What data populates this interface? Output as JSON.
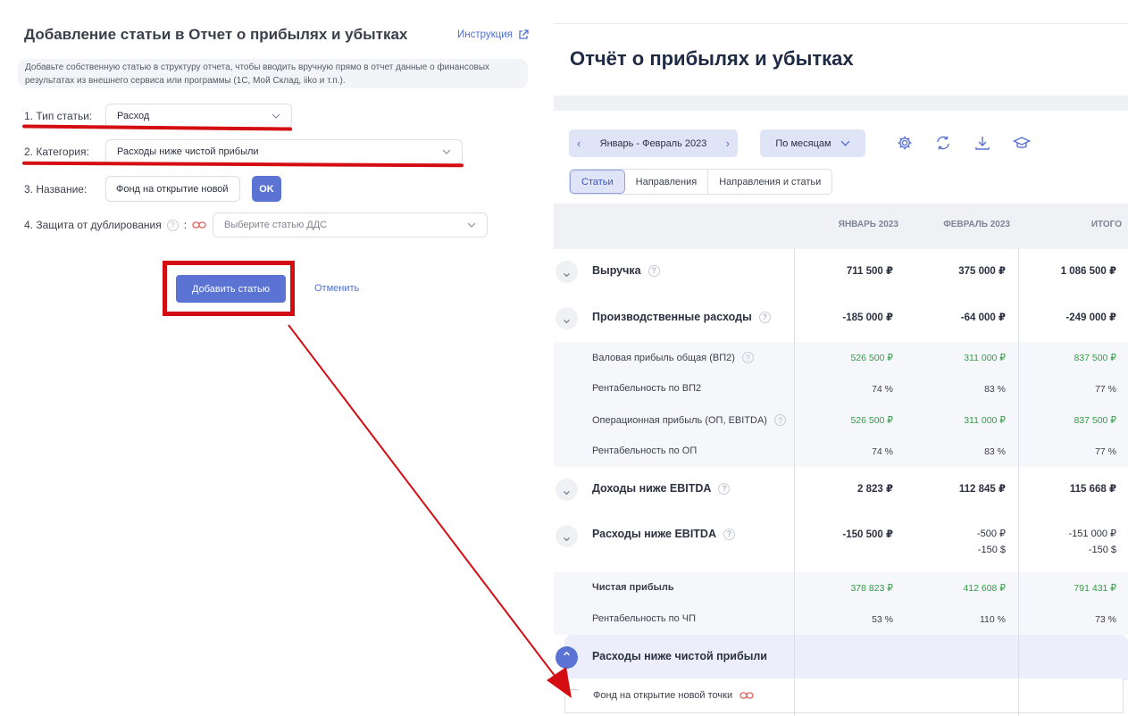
{
  "left_panel": {
    "title": "Добавление статьи в Отчет о прибылях и убытках",
    "instruction_link": "Инструкция",
    "note": "Добавьте собственную статью в структуру отчета, чтобы вводить вручную прямо в отчет данные о финансовых результатах из внешнего сервиса или программы (1С, Мой Склад, iiko и т.п.).",
    "type_label": "1. Тип статьи:",
    "type_value": "Расход",
    "category_label": "2. Категория:",
    "category_value": "Расходы ниже чистой прибыли",
    "name_label": "3. Название:",
    "name_value": "Фонд на открытие новой",
    "ok_label": "OK",
    "dup_label": "4. Защита от дублирования",
    "dup_placeholder": "Выберите статью ДДС",
    "add_button": "Добавить статью",
    "cancel_button": "Отменить",
    "annotation_color": "#d40d12",
    "accent_color": "#5b73d2"
  },
  "report": {
    "title": "Отчёт о прибылях и убытках",
    "period": "Январь - Февраль 2023",
    "grouping": "По месяцам",
    "toolbar_icons": [
      "gear-icon",
      "refresh-icon",
      "download-icon",
      "graduation-cap-icon"
    ],
    "tabs": [
      "Статьи",
      "Направления",
      "Направления и статьи"
    ],
    "active_tab": "Статьи",
    "columns": [
      "ЯНВАРЬ 2023",
      "ФЕВРАЛЬ 2023",
      "ИТОГО"
    ],
    "rows": [
      {
        "name": "Выручка",
        "jan": "711 500 ₽",
        "feb": "375 000 ₽",
        "total": "1 086 500 ₽"
      },
      {
        "name": "Производственные расходы",
        "jan": "-185 000 ₽",
        "feb": "-64 000 ₽",
        "total": "-249 000 ₽"
      },
      {
        "name": "Валовая прибыль общая (ВП2)",
        "jan": "526 500 ₽",
        "feb": "311 000 ₽",
        "total": "837 500 ₽"
      },
      {
        "name": "Рентабельность по ВП2",
        "jan": "74 %",
        "feb": "83 %",
        "total": "77 %"
      },
      {
        "name": "Операционная прибыль (ОП, EBITDA)",
        "jan": "526 500 ₽",
        "feb": "311 000 ₽",
        "total": "837 500 ₽"
      },
      {
        "name": "Рентабельность по ОП",
        "jan": "74 %",
        "feb": "83 %",
        "total": "77 %"
      },
      {
        "name": "Доходы ниже EBITDA",
        "jan": "2 823 ₽",
        "feb": "112 845 ₽",
        "total": "115 668 ₽"
      },
      {
        "name": "Расходы ниже EBITDA",
        "jan": "-150 500 ₽",
        "feb": "-500 ₽",
        "feb2": "-150 $",
        "total": "-151 000 ₽",
        "total2": "-150 $"
      },
      {
        "name": "Чистая прибыль",
        "jan": "378 823 ₽",
        "feb": "412 608 ₽",
        "total": "791 431 ₽"
      },
      {
        "name": "Рентабельность по ЧП",
        "jan": "53 %",
        "feb": "110 %",
        "total": "73 %"
      },
      {
        "name": "Расходы ниже чистой прибыли"
      },
      {
        "name": "Фонд на открытие новой точки"
      }
    ],
    "positive_color": "#2f9e44"
  }
}
